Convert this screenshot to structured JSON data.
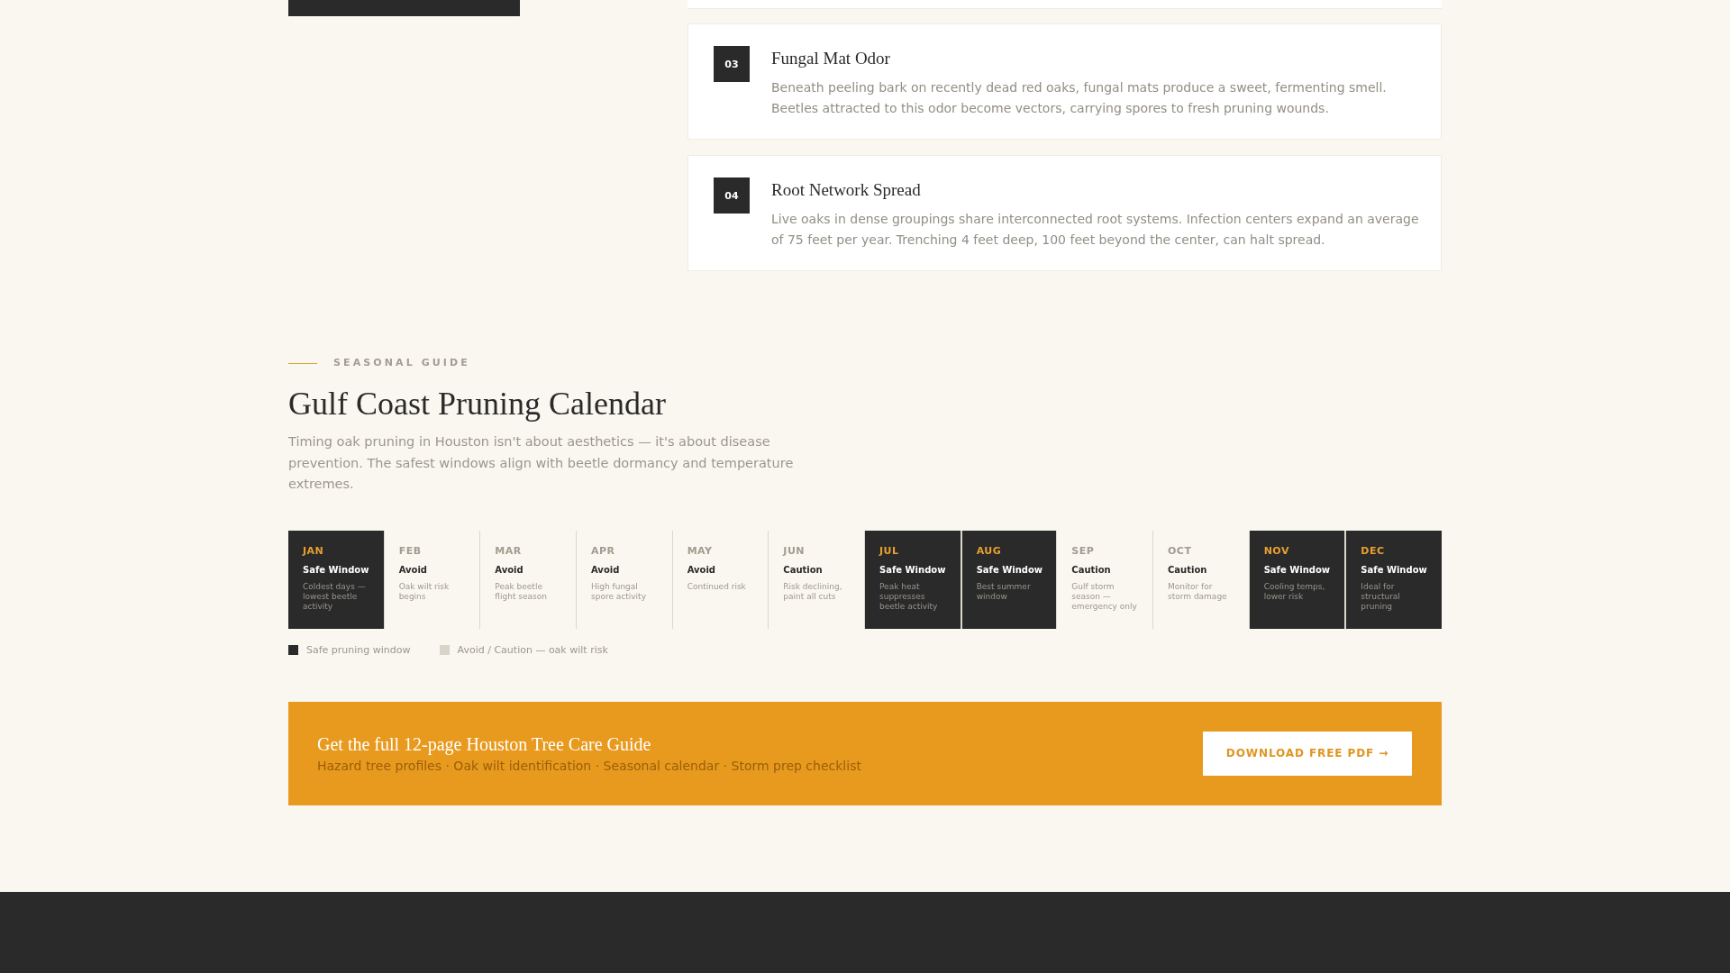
{
  "causes": [
    {
      "number": "03",
      "title": "Fungal Mat Odor",
      "text": "Beneath peeling bark on recently dead red oaks, fungal mats produce a sweet, fermenting smell. Beetles attracted to this odor become vectors, carrying spores to fresh pruning wounds."
    },
    {
      "number": "04",
      "title": "Root Network Spread",
      "text": "Live oaks in dense groupings share interconnected root systems. Infection centers expand an average of 75 feet per year. Trenching 4 feet deep, 100 feet beyond the center, can halt spread."
    }
  ],
  "seasonal_guide": {
    "eyebrow": "SEASONAL GUIDE",
    "title": "Gulf Coast Pruning Calendar",
    "intro": "Timing oak pruning in Houston isn't about aesthetics — it's about disease prevention. The safest windows align with beetle dormancy and temperature extremes.",
    "months": [
      {
        "month": "JAN",
        "status": "Safe Window",
        "note": "Coldest days — lowest beetle activity",
        "kind": "safe"
      },
      {
        "month": "FEB",
        "status": "Avoid",
        "note": "Oak wilt risk begins",
        "kind": "risk"
      },
      {
        "month": "MAR",
        "status": "Avoid",
        "note": "Peak beetle flight season",
        "kind": "risk"
      },
      {
        "month": "APR",
        "status": "Avoid",
        "note": "High fungal spore activity",
        "kind": "risk"
      },
      {
        "month": "MAY",
        "status": "Avoid",
        "note": "Continued risk",
        "kind": "risk"
      },
      {
        "month": "JUN",
        "status": "Caution",
        "note": "Risk declining, paint all cuts",
        "kind": "risk"
      },
      {
        "month": "JUL",
        "status": "Safe Window",
        "note": "Peak heat suppresses beetle activity",
        "kind": "safe"
      },
      {
        "month": "AUG",
        "status": "Safe Window",
        "note": "Best summer window",
        "kind": "safe"
      },
      {
        "month": "SEP",
        "status": "Caution",
        "note": "Gulf storm season — emergency only",
        "kind": "risk"
      },
      {
        "month": "OCT",
        "status": "Caution",
        "note": "Monitor for storm damage",
        "kind": "risk"
      },
      {
        "month": "NOV",
        "status": "Safe Window",
        "note": "Cooling temps, lower risk",
        "kind": "safe"
      },
      {
        "month": "DEC",
        "status": "Safe Window",
        "note": "Ideal for structural pruning",
        "kind": "safe"
      }
    ],
    "legend": [
      {
        "label": "Safe pruning window",
        "kind": "safe"
      },
      {
        "label": "Avoid / Caution — oak wilt risk",
        "kind": "risk"
      }
    ]
  },
  "cta": {
    "title": "Get the full 12-page Houston Tree Care Guide",
    "subtitle": "Hazard tree profiles · Oak wilt identification · Seasonal calendar · Storm prep checklist",
    "button": "DOWNLOAD FREE PDF →"
  }
}
